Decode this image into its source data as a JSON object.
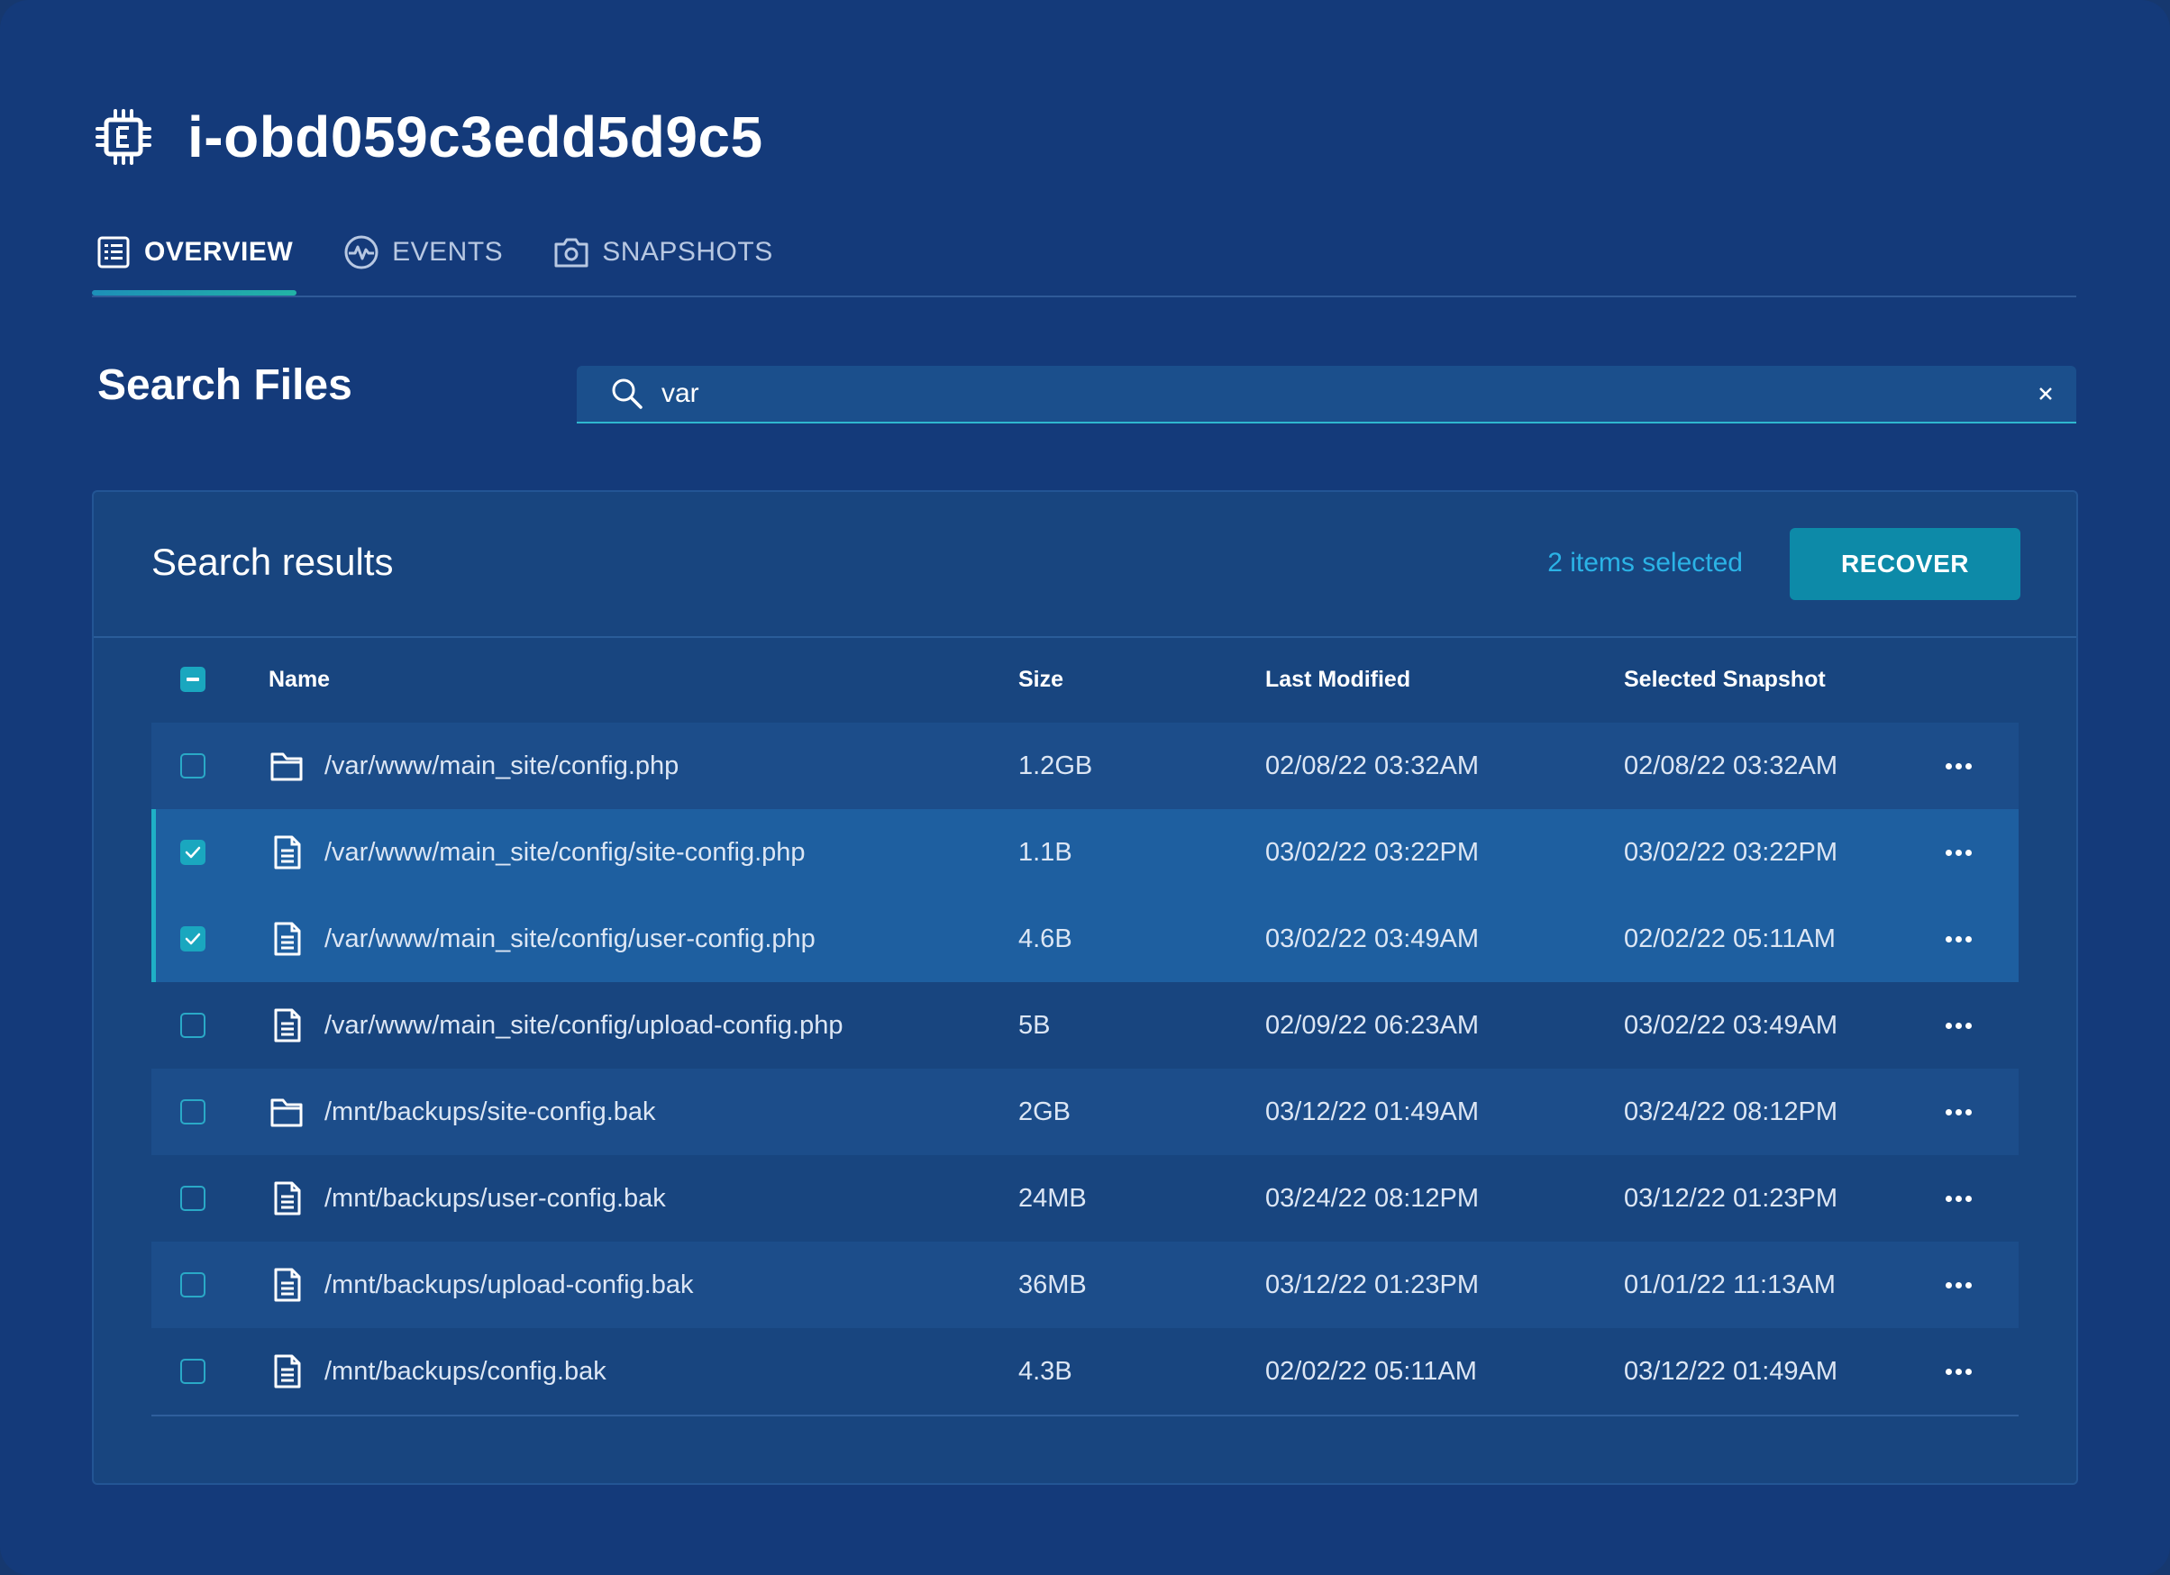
{
  "instance": {
    "id": "i-obd059c3edd5d9c5",
    "icon": "chip-icon"
  },
  "tabs": [
    {
      "label": "OVERVIEW",
      "icon": "list-icon",
      "active": true
    },
    {
      "label": "EVENTS",
      "icon": "activity-icon",
      "active": false
    },
    {
      "label": "SNAPSHOTS",
      "icon": "camera-icon",
      "active": false
    }
  ],
  "search": {
    "title": "Search Files",
    "value": "var"
  },
  "results": {
    "title": "Search results",
    "selected_count": "2 items selected",
    "recover_label": "RECOVER",
    "columns": {
      "name": "Name",
      "size": "Size",
      "modified": "Last Modified",
      "snapshot": "Selected Snapshot"
    },
    "rows": [
      {
        "name": "/var/www/main_site/config.php",
        "type": "folder",
        "size": "1.2GB",
        "modified": "02/08/22 03:32AM",
        "snapshot": "02/08/22 03:32AM",
        "checked": false
      },
      {
        "name": "/var/www/main_site/config/site-config.php",
        "type": "file",
        "size": "1.1B",
        "modified": "03/02/22 03:22PM",
        "snapshot": "03/02/22 03:22PM",
        "checked": true
      },
      {
        "name": "/var/www/main_site/config/user-config.php",
        "type": "file",
        "size": "4.6B",
        "modified": "03/02/22 03:49AM",
        "snapshot": "02/02/22 05:11AM",
        "checked": true
      },
      {
        "name": "/var/www/main_site/config/upload-config.php",
        "type": "file",
        "size": "5B",
        "modified": "02/09/22 06:23AM",
        "snapshot": "03/02/22 03:49AM",
        "checked": false
      },
      {
        "name": "/mnt/backups/site-config.bak",
        "type": "folder",
        "size": "2GB",
        "modified": "03/12/22 01:49AM",
        "snapshot": "03/24/22 08:12PM",
        "checked": false
      },
      {
        "name": "/mnt/backups/user-config.bak",
        "type": "file",
        "size": "24MB",
        "modified": "03/24/22 08:12PM",
        "snapshot": "03/12/22 01:23PM",
        "checked": false
      },
      {
        "name": "/mnt/backups/upload-config.bak",
        "type": "file",
        "size": "36MB",
        "modified": "03/12/22 01:23PM",
        "snapshot": "01/01/22 11:13AM",
        "checked": false
      },
      {
        "name": "/mnt/backups/config.bak",
        "type": "file",
        "size": "4.3B",
        "modified": "02/02/22 05:11AM",
        "snapshot": "03/12/22 01:49AM",
        "checked": false
      }
    ]
  },
  "colors": {
    "background": "#143a7a",
    "panel": "#18457f",
    "accent": "#1aa7bf",
    "button": "#0d8aa8",
    "link": "#2bb3e6"
  }
}
